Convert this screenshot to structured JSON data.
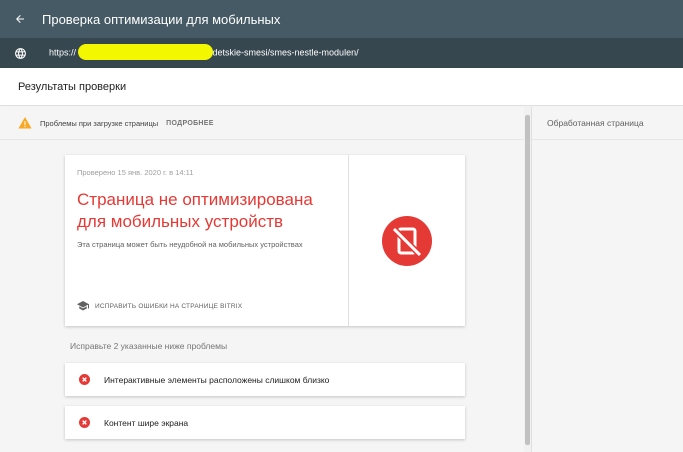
{
  "appbar": {
    "back_icon": "arrow-left-icon",
    "title": "Проверка оптимизации для мобильных"
  },
  "urlbar": {
    "icon": "globe-icon",
    "url_prefix": "https://",
    "url_suffix": "g/detskie-smesi/smes-nestle-modulen/"
  },
  "results_header": {
    "title": "Результаты проверки"
  },
  "warning": {
    "icon": "warning-icon",
    "text": "Проблемы при загрузке страницы",
    "more_label": "ПОДРОБНЕЕ"
  },
  "right_panel": {
    "title": "Обработанная страница"
  },
  "result_card": {
    "checked_at": "Проверено 15 янв. 2020 г. в 14:11",
    "verdict": "Страница не оптимизирована для мобильных устройств",
    "subtext": "Эта страница может быть неудобной на мобильных устройствах",
    "fix_label": "ИСПРАВИТЬ ОШИБКИ НА СТРАНИЦЕ BITRIX",
    "status_icon": "not-mobile-friendly-icon"
  },
  "issues": {
    "heading": "Исправьте 2 указанные ниже проблемы",
    "items": [
      {
        "icon": "error-icon",
        "label": "Интерактивные элементы расположены слишком близко"
      },
      {
        "icon": "error-icon",
        "label": "Контент шире экрана"
      }
    ]
  },
  "colors": {
    "appbar": "#455a64",
    "urlbar": "#37474f",
    "error_red": "#e53935",
    "warning_yellow": "#f9a825"
  }
}
